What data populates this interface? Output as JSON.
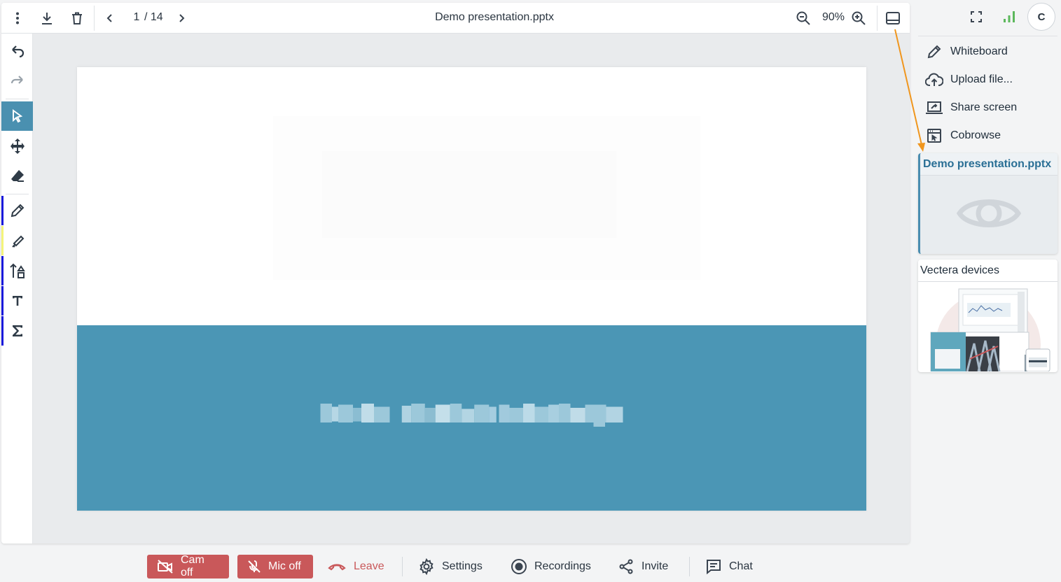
{
  "toolbar": {
    "more_icon": "more-vertical-icon",
    "download_icon": "download-icon",
    "delete_icon": "trash-icon",
    "prev_icon": "chevron-left-icon",
    "next_icon": "chevron-right-icon",
    "page_current": "1",
    "page_total": "/ 14",
    "document_title": "Demo presentation.pptx",
    "zoom_out_icon": "zoom-out-icon",
    "zoom_value": "90%",
    "zoom_in_icon": "zoom-in-icon",
    "panel_toggle_icon": "panel-bottom-icon"
  },
  "tools": [
    {
      "name": "undo",
      "icon": "undo-icon"
    },
    {
      "name": "redo",
      "icon": "redo-icon",
      "disabled": true
    },
    {
      "name": "select",
      "icon": "pointer-icon",
      "active": true
    },
    {
      "name": "move",
      "icon": "move-icon"
    },
    {
      "name": "eraser",
      "icon": "eraser-icon"
    },
    {
      "name": "pen",
      "icon": "pencil-icon",
      "color": "#1a1adb"
    },
    {
      "name": "highlighter",
      "icon": "highlighter-icon",
      "color": "#f4f47a"
    },
    {
      "name": "shapes",
      "icon": "shapes-icon",
      "color": "#1a1adb"
    },
    {
      "name": "text",
      "icon": "text-icon",
      "color": "#1a1adb"
    },
    {
      "name": "formula",
      "icon": "sigma-icon",
      "color": "#1a1adb"
    }
  ],
  "slide": {
    "band_color": "#4b96b5",
    "accent": "#4a90b0"
  },
  "sidebar": {
    "fullscreen_icon": "fullscreen-icon",
    "signal_icon": "signal-bars-icon",
    "avatar_initial": "C",
    "menu": [
      {
        "label": "Whiteboard",
        "icon": "pencil-icon"
      },
      {
        "label": "Upload file...",
        "icon": "cloud-upload-icon"
      },
      {
        "label": "Share screen",
        "icon": "share-screen-icon"
      },
      {
        "label": "Cobrowse",
        "icon": "cobrowse-icon"
      }
    ],
    "cards": [
      {
        "title": "Demo presentation.pptx",
        "icon": "eye-icon",
        "active": true
      },
      {
        "title": "Vectera devices"
      }
    ]
  },
  "bottom_bar": {
    "cam_label": "Cam off",
    "mic_label": "Mic off",
    "leave_label": "Leave",
    "settings_label": "Settings",
    "recordings_label": "Recordings",
    "invite_label": "Invite",
    "chat_label": "Chat",
    "danger_color": "#c9585a"
  },
  "annotation_color": "#f0961e"
}
